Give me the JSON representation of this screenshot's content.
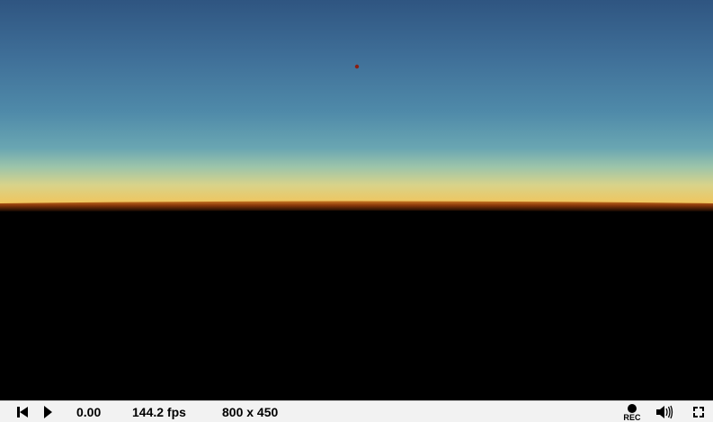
{
  "viewport": {
    "scene": "dusk-sky-render",
    "colors": {
      "sky_top": "#315782",
      "sky_mid": "#4c86a8",
      "sky_low": "#8cbeb7",
      "horizon_glow": "#e6d47e",
      "horizon_orange": "#9a4310",
      "ground": "#000000",
      "marker": "#8a1f12"
    }
  },
  "controls": {
    "time": "0.00",
    "fps": "144.2 fps",
    "resolution": "800 x 450",
    "record_label": "REC",
    "icons": {
      "rewind": "skip-back-icon",
      "play": "play-icon",
      "record": "record-icon",
      "volume": "volume-icon",
      "fullscreen": "fullscreen-icon"
    },
    "colors": {
      "bar_background": "#f2f2f2",
      "text": "#000000"
    }
  }
}
